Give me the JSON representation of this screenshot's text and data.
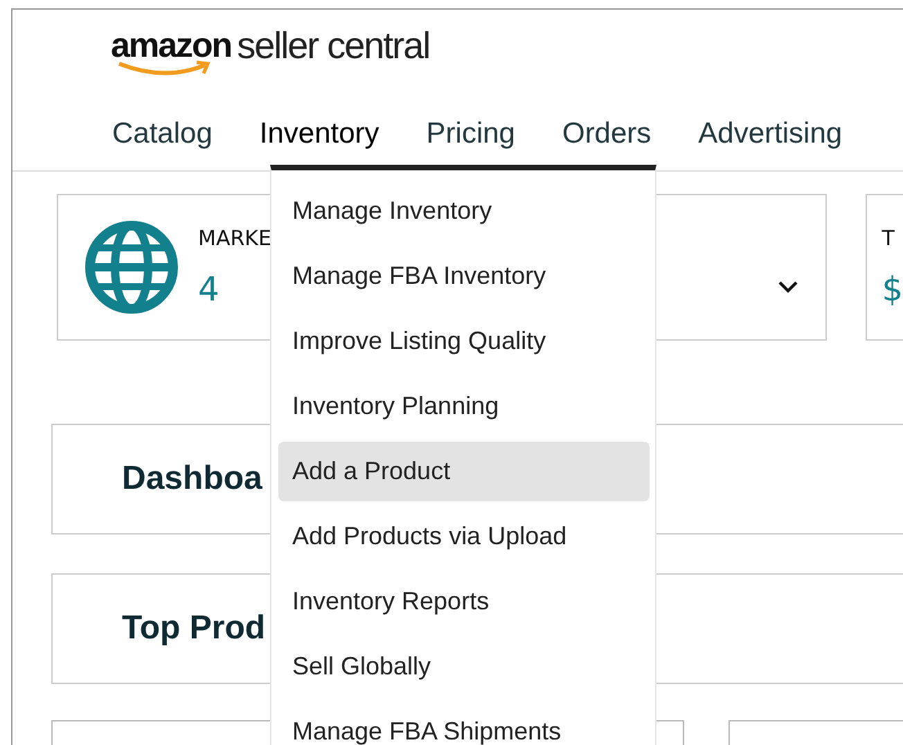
{
  "header": {
    "logo_brand": "amazon",
    "logo_product": "seller central"
  },
  "nav": [
    {
      "label": "Catalog",
      "selected": false
    },
    {
      "label": "Inventory",
      "selected": true
    },
    {
      "label": "Pricing",
      "selected": false
    },
    {
      "label": "Orders",
      "selected": false
    },
    {
      "label": "Advertising",
      "selected": false
    }
  ],
  "dropdown": [
    {
      "label": "Manage Inventory",
      "selected": false
    },
    {
      "label": "Manage FBA Inventory",
      "selected": false
    },
    {
      "label": "Improve Listing Quality",
      "selected": false
    },
    {
      "label": "Inventory Planning",
      "selected": false
    },
    {
      "label": "Add a Product",
      "selected": true
    },
    {
      "label": "Add Products via Upload",
      "selected": false
    },
    {
      "label": "Inventory Reports",
      "selected": false
    },
    {
      "label": "Sell Globally",
      "selected": false
    },
    {
      "label": "Manage FBA Shipments",
      "selected": false
    }
  ],
  "marketplaces_card": {
    "label": "MARKE",
    "value": "4"
  },
  "second_card": {
    "label": "T",
    "value": "$"
  },
  "sections": [
    "Dashboa",
    "Top Prod"
  ]
}
